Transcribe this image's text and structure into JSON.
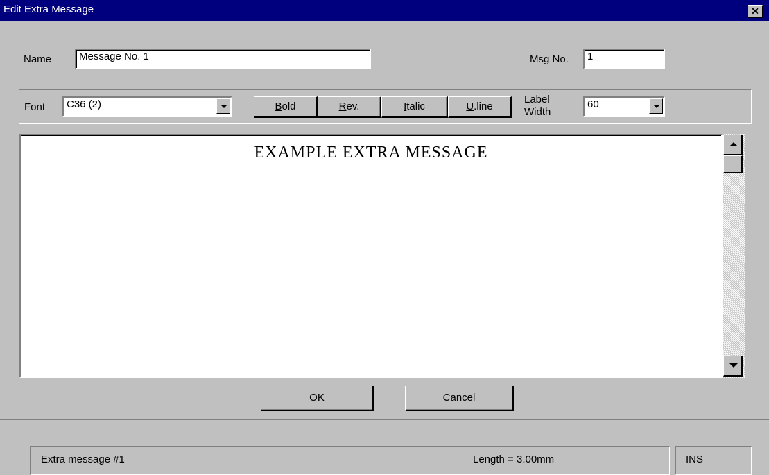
{
  "window": {
    "title": "Edit Extra Message",
    "close_glyph": "✕"
  },
  "name_field": {
    "label": "Name",
    "value": "Message No. 1"
  },
  "msg_no_field": {
    "label": "Msg No.",
    "value": "1"
  },
  "font_field": {
    "label": "Font",
    "value": "C36 (2)"
  },
  "format_buttons": {
    "bold_first": "B",
    "bold_rest": "old",
    "rev_first": "R",
    "rev_rest": "ev.",
    "italic_first": "I",
    "italic_rest": "talic",
    "uline_first": "U",
    "uline_rest": ".line"
  },
  "label_width": {
    "label_line1": "Label",
    "label_line2": "Width",
    "value": "60"
  },
  "editor": {
    "text": "EXAMPLE  EXTRA  MESSAGE"
  },
  "buttons": {
    "ok": "OK",
    "cancel": "Cancel"
  },
  "status_bar": {
    "message": "Extra message #1",
    "length": "Length = 3.00mm",
    "mode": "INS"
  }
}
